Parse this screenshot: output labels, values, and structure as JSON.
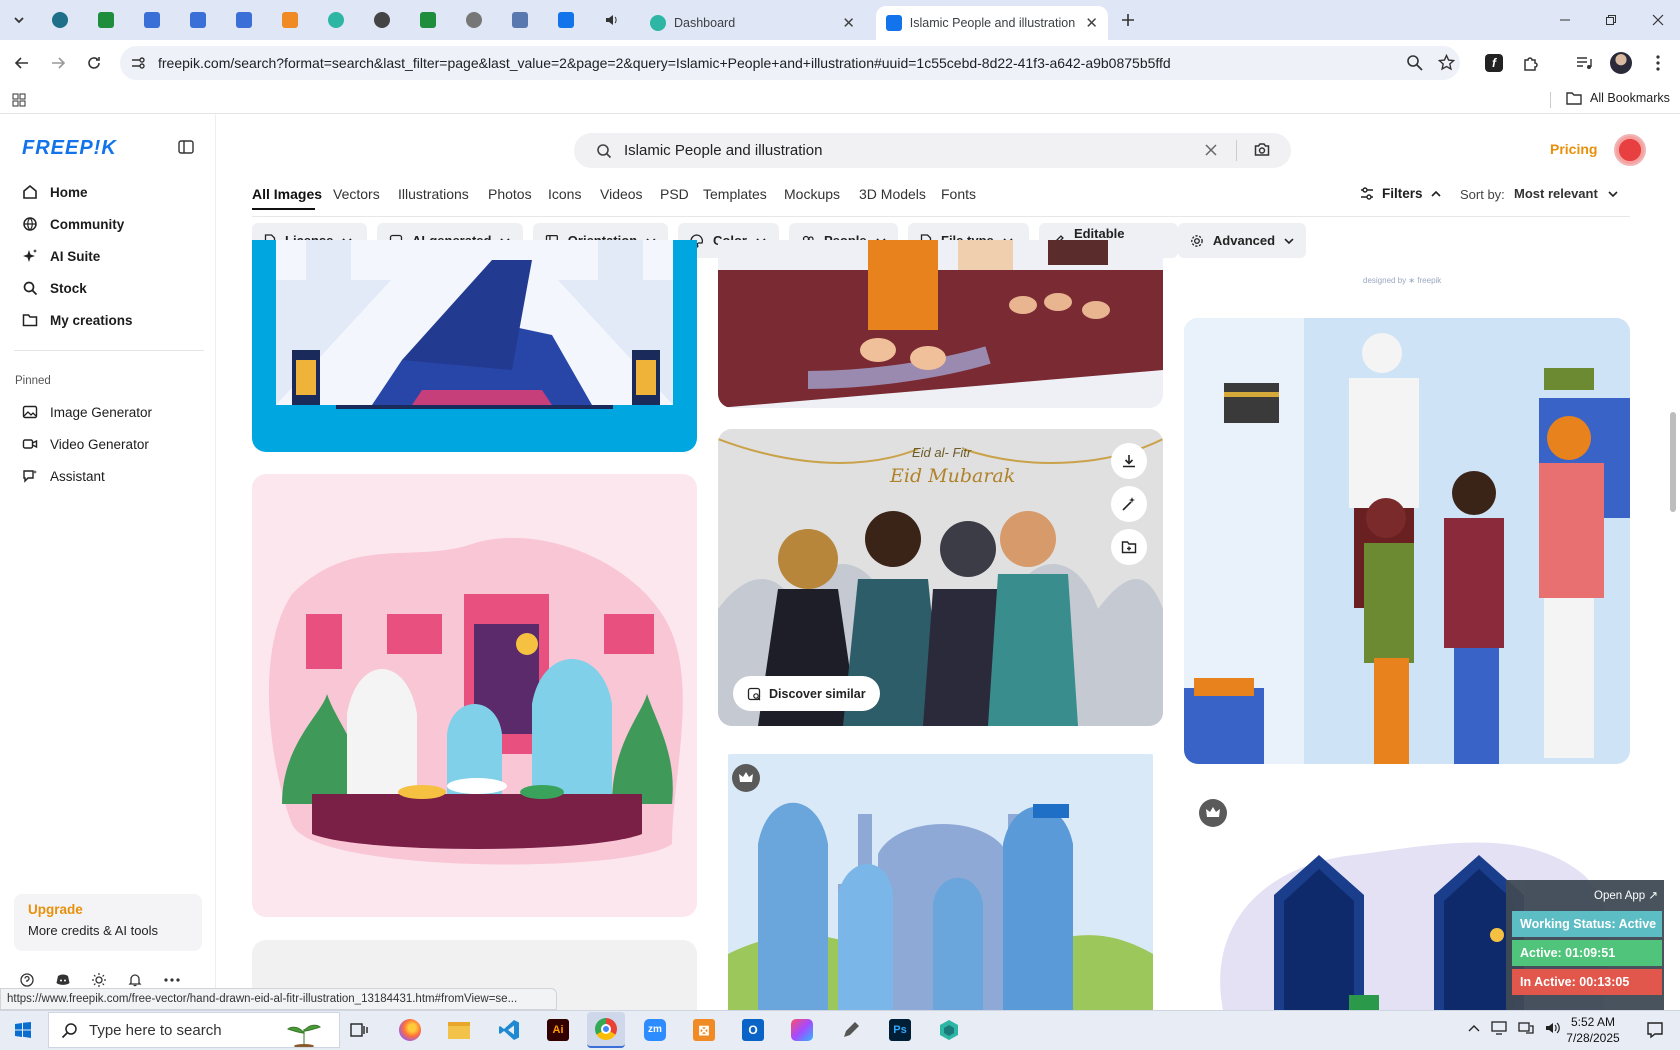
{
  "browser": {
    "tabs": [
      {
        "label": "Dashboard"
      },
      {
        "label": "Islamic People and illustration v"
      }
    ],
    "url": "freepik.com/search?format=search&last_filter=page&last_value=2&page=2&query=Islamic+People+and+illustration#uuid=1c55cebd-8d22-41f3-a642-a9b0875b5ffd",
    "bookmarks_label": "All Bookmarks",
    "status_url": "https://www.freepik.com/free-vector/hand-drawn-eid-al-fitr-illustration_13184431.htm#fromView=se..."
  },
  "sidebar": {
    "logo": "FREEP!K",
    "items": [
      {
        "label": "Home",
        "icon": "home-icon"
      },
      {
        "label": "Community",
        "icon": "globe-icon"
      },
      {
        "label": "AI Suite",
        "icon": "sparkle-icon"
      },
      {
        "label": "Stock",
        "icon": "search-icon"
      },
      {
        "label": "My creations",
        "icon": "folder-icon"
      }
    ],
    "pinned_label": "Pinned",
    "pinned": [
      {
        "label": "Image Generator",
        "icon": "image-icon"
      },
      {
        "label": "Video Generator",
        "icon": "video-icon"
      },
      {
        "label": "Assistant",
        "icon": "chat-icon"
      }
    ],
    "upgrade_title": "Upgrade",
    "upgrade_subtitle": "More credits & AI tools"
  },
  "header": {
    "search_value": "Islamic People and illustration",
    "pricing": "Pricing"
  },
  "filter_tabs": [
    "All Images",
    "Vectors",
    "Illustrations",
    "Photos",
    "Icons",
    "Videos",
    "PSD",
    "Templates",
    "Mockups",
    "3D Models",
    "Fonts"
  ],
  "filters_label": "Filters",
  "sort_label": "Sort by:",
  "sort_value": "Most relevant",
  "chips": [
    "License",
    "AI-generated",
    "Orientation",
    "Color",
    "People",
    "File type",
    "Editable online",
    "Advanced"
  ],
  "cards": {
    "discover_similar": "Discover similar",
    "eid_heading": "Eid al- Fitr",
    "eid_script": "Eid Mubarak",
    "watermark": "designed by ∗ freepik"
  },
  "tracker": {
    "open_app": "Open App ↗",
    "status": "Working Status: Active",
    "active": "Active: 01:09:51",
    "inactive": "In Active: 00:13:05"
  },
  "taskbar": {
    "search_placeholder": "Type here to search",
    "time": "5:52 AM",
    "date": "7/28/2025"
  },
  "colors": {
    "brand": "#1273eb",
    "pricing": "#e8900c",
    "tab_strip": "#dfe6f5",
    "status_active": "#5dbdc4",
    "active_green": "#4fc47a",
    "inactive_red": "#e2574c"
  }
}
